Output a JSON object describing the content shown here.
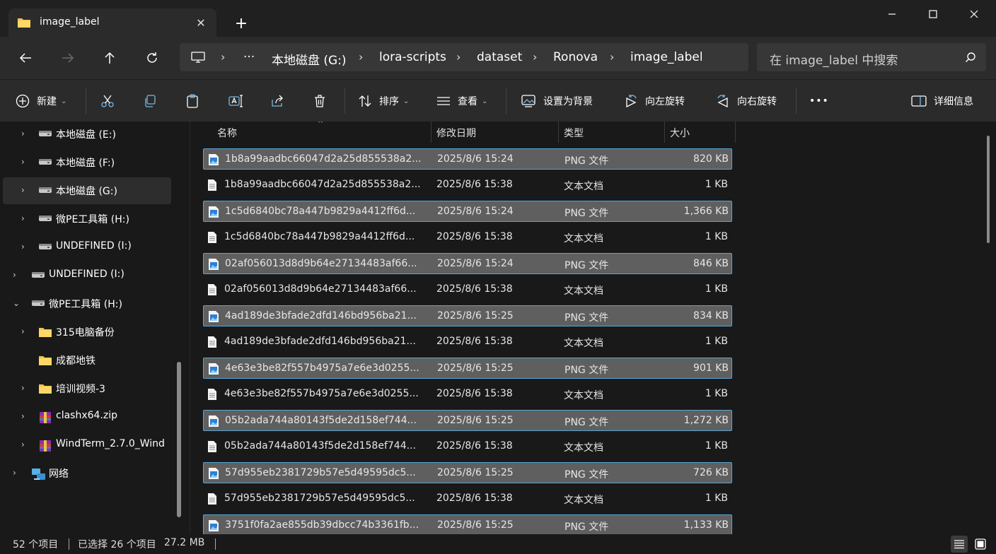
{
  "tab": {
    "title": "image_label",
    "close": "✕",
    "new_tab": "+"
  },
  "window": {
    "minimize": "—",
    "maximize": "☐",
    "close": "✕"
  },
  "address": {
    "overflow": "···",
    "crumbs": [
      "本地磁盘 (G:)",
      "lora-scripts",
      "dataset",
      "Ronova",
      "image_label"
    ],
    "separator": "›"
  },
  "search": {
    "placeholder": "在 image_label 中搜索"
  },
  "commands": {
    "new": "新建",
    "sort": "排序",
    "view": "查看",
    "set_background": "设置为背景",
    "rotate_left": "向左旋转",
    "rotate_right": "向右旋转",
    "more": "•••",
    "details": "详细信息"
  },
  "nav": {
    "items": [
      {
        "label": "本地磁盘 (E:)",
        "kind": "drive",
        "expander": "›"
      },
      {
        "label": "本地磁盘 (F:)",
        "kind": "drive",
        "expander": "›"
      },
      {
        "label": "本地磁盘 (G:)",
        "kind": "drive",
        "expander": "›",
        "selected": true
      },
      {
        "label": "微PE工具箱 (H:)",
        "kind": "drive",
        "expander": "›"
      },
      {
        "label": "UNDEFINED (I:)",
        "kind": "drive",
        "expander": "›"
      },
      {
        "label": "UNDEFINED (I:)",
        "kind": "drive",
        "expander": "›"
      },
      {
        "label": "微PE工具箱 (H:)",
        "kind": "drive",
        "expander": "⌄"
      },
      {
        "label": "315电脑备份",
        "kind": "folder",
        "expander": "›"
      },
      {
        "label": "成都地铁",
        "kind": "folder",
        "expander": ""
      },
      {
        "label": "培训视频-3",
        "kind": "folder",
        "expander": "›"
      },
      {
        "label": "clashx64.zip",
        "kind": "archive",
        "expander": "›"
      },
      {
        "label": "WindTerm_2.7.0_Wind",
        "kind": "archive",
        "expander": "›"
      },
      {
        "label": "网络",
        "kind": "network",
        "expander": "›"
      }
    ]
  },
  "columns": {
    "name": "名称",
    "date": "修改日期",
    "type": "类型",
    "size": "大小",
    "sort_caret": "^"
  },
  "files": [
    {
      "name": "1b8a99aadbc66047d2a25d855538a2...",
      "date": "2025/8/6 15:24",
      "type": "PNG 文件",
      "size": "820 KB",
      "icon": "png-file-icon",
      "selected": true
    },
    {
      "name": "1b8a99aadbc66047d2a25d855538a2...",
      "date": "2025/8/6 15:38",
      "type": "文本文档",
      "size": "1 KB",
      "icon": "text-file-icon",
      "selected": false
    },
    {
      "name": "1c5d6840bc78a447b9829a4412ff6d...",
      "date": "2025/8/6 15:24",
      "type": "PNG 文件",
      "size": "1,366 KB",
      "icon": "png-file-icon",
      "selected": true
    },
    {
      "name": "1c5d6840bc78a447b9829a4412ff6d...",
      "date": "2025/8/6 15:38",
      "type": "文本文档",
      "size": "1 KB",
      "icon": "text-file-icon",
      "selected": false
    },
    {
      "name": "02af056013d8d9b64e27134483af66...",
      "date": "2025/8/6 15:24",
      "type": "PNG 文件",
      "size": "846 KB",
      "icon": "png-file-icon",
      "selected": true
    },
    {
      "name": "02af056013d8d9b64e27134483af66...",
      "date": "2025/8/6 15:38",
      "type": "文本文档",
      "size": "1 KB",
      "icon": "text-file-icon",
      "selected": false
    },
    {
      "name": "4ad189de3bfade2dfd146bd956ba21...",
      "date": "2025/8/6 15:25",
      "type": "PNG 文件",
      "size": "834 KB",
      "icon": "png-file-icon",
      "selected": true
    },
    {
      "name": "4ad189de3bfade2dfd146bd956ba21...",
      "date": "2025/8/6 15:38",
      "type": "文本文档",
      "size": "1 KB",
      "icon": "text-file-icon",
      "selected": false
    },
    {
      "name": "4e63e3be82f557b4975a7e6e3d0255...",
      "date": "2025/8/6 15:25",
      "type": "PNG 文件",
      "size": "901 KB",
      "icon": "png-file-icon",
      "selected": true
    },
    {
      "name": "4e63e3be82f557b4975a7e6e3d0255...",
      "date": "2025/8/6 15:38",
      "type": "文本文档",
      "size": "1 KB",
      "icon": "text-file-icon",
      "selected": false
    },
    {
      "name": "05b2ada744a80143f5de2d158ef744...",
      "date": "2025/8/6 15:25",
      "type": "PNG 文件",
      "size": "1,272 KB",
      "icon": "png-file-icon",
      "selected": true
    },
    {
      "name": "05b2ada744a80143f5de2d158ef744...",
      "date": "2025/8/6 15:38",
      "type": "文本文档",
      "size": "1 KB",
      "icon": "text-file-icon",
      "selected": false
    },
    {
      "name": "57d955eb2381729b57e5d49595dc5...",
      "date": "2025/8/6 15:25",
      "type": "PNG 文件",
      "size": "726 KB",
      "icon": "png-file-icon",
      "selected": true
    },
    {
      "name": "57d955eb2381729b57e5d49595dc5...",
      "date": "2025/8/6 15:38",
      "type": "文本文档",
      "size": "1 KB",
      "icon": "text-file-icon",
      "selected": false
    },
    {
      "name": "3751f0fa2ae855db39dbcc74b3361fb...",
      "date": "2025/8/6 15:25",
      "type": "PNG 文件",
      "size": "1,133 KB",
      "icon": "png-file-icon",
      "selected": true
    }
  ],
  "status": {
    "count": "52 个项目",
    "selection": "已选择 26 个项目",
    "selection_size": "27.2 MB"
  },
  "colors": {
    "selection_fill": "#5f5f5f",
    "selection_border": "#58a6d6",
    "folder": "#f3c34a"
  }
}
